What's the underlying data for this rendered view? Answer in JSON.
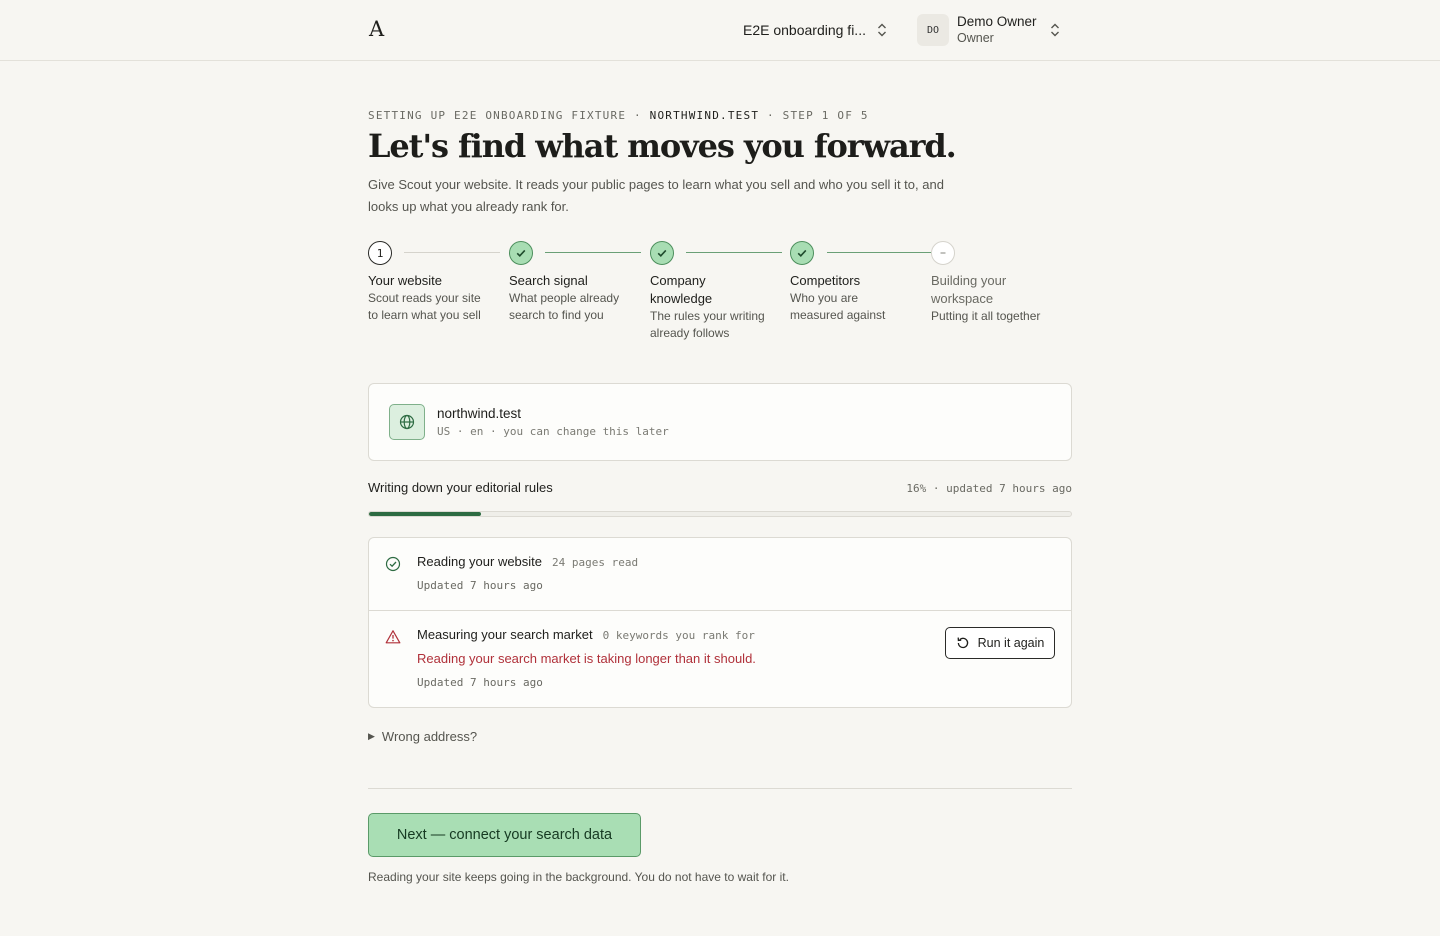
{
  "header": {
    "logo": "A",
    "workspace": "E2E onboarding fi...",
    "user": {
      "initials": "DO",
      "name": "Demo Owner",
      "role": "Owner"
    }
  },
  "intro": {
    "eyebrow_prefix": "SETTING UP E2E ONBOARDING FIXTURE ·",
    "eyebrow_domain": "NORTHWIND.TEST",
    "eyebrow_suffix": "· STEP 1 OF 5",
    "headline": "Let's find what moves you forward.",
    "lead": "Give Scout your website. It reads your public pages to learn what you sell and who you sell it to, and looks up what you already rank for."
  },
  "steps": [
    {
      "number": "1",
      "state": "current",
      "title": "Your website",
      "desc": "Scout reads your site to learn what you sell"
    },
    {
      "number": "2",
      "state": "done",
      "title": "Search signal",
      "desc": "What people already search to find you"
    },
    {
      "number": "3",
      "state": "done",
      "title": "Company knowledge",
      "desc": "The rules your writing already follows"
    },
    {
      "number": "4",
      "state": "done",
      "title": "Competitors",
      "desc": "Who you are measured against"
    },
    {
      "number": "5",
      "state": "pending",
      "title": "Building your workspace",
      "desc": "Putting it all together"
    }
  ],
  "site": {
    "domain": "northwind.test",
    "meta": "US · en · you can change this later"
  },
  "progress": {
    "label": "Writing down your editorial rules",
    "meta": "16% · updated 7 hours ago",
    "percent": 16
  },
  "tasks": {
    "reading": {
      "title": "Reading your website",
      "note": "24 pages read",
      "updated": "Updated 7 hours ago"
    },
    "measuring": {
      "title": "Measuring your search market",
      "note": "0 keywords you rank for",
      "error": "Reading your search market is taking longer than it should.",
      "updated": "Updated 7 hours ago",
      "button": "Run it again"
    }
  },
  "wrong_address": "Wrong address?",
  "next_button": "Next — connect your search data",
  "footnote": "Reading your site keeps going in the background. You do not have to wait for it.",
  "colors": {
    "accent": "#2d6b42",
    "success_fill": "#a8ddb3",
    "error": "#b0313a"
  }
}
